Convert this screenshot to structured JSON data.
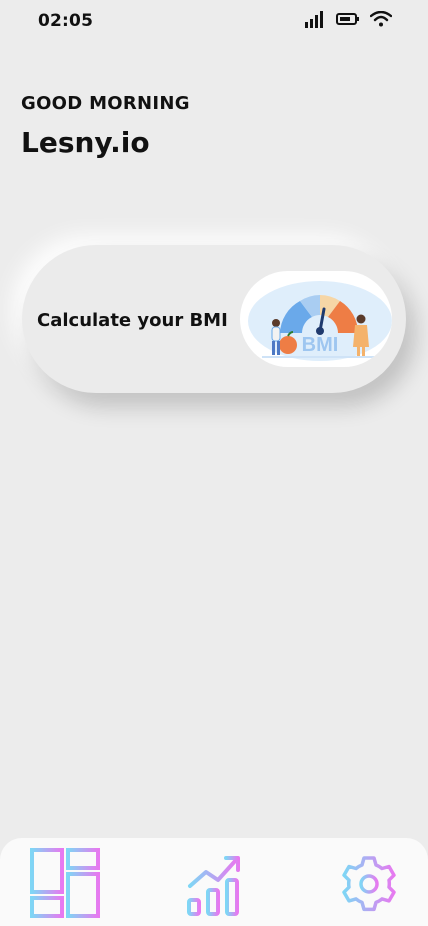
{
  "status": {
    "time": "02:05"
  },
  "home": {
    "greeting": "GOOD MORNING",
    "username": "Lesny.io"
  },
  "bmi_card": {
    "label": "Calculate your BMI",
    "illustration_text": "BMI"
  },
  "nav": {
    "items": [
      {
        "icon": "dashboard-icon"
      },
      {
        "icon": "chart-icon"
      },
      {
        "icon": "settings-icon"
      }
    ],
    "gradient": [
      "#7fd6f5",
      "#e779f0"
    ]
  }
}
